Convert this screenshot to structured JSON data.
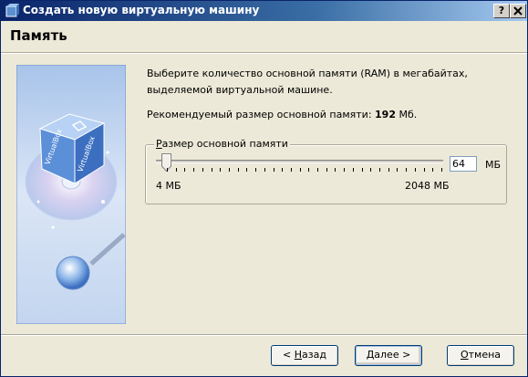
{
  "window": {
    "title": "Создать новую виртуальную машину",
    "help_button": "?",
    "close_button": "X"
  },
  "page": {
    "title": "Память"
  },
  "description": "Выберите количество основной памяти (RAM) в мегабайтах, выделяемой виртуальной машине.",
  "recommended": {
    "prefix": "Рекомендуемый размер основной памяти: ",
    "value": "192",
    "suffix": " Мб."
  },
  "memory_group": {
    "label_mnemonic": "Р",
    "label_rest": "азмер основной памяти",
    "min_label": "4 МБ",
    "max_label": "2048 МБ",
    "value": "64",
    "unit": "МБ",
    "slider_min": 4,
    "slider_max": 2048,
    "slider_value": 64
  },
  "buttons": {
    "back_prefix": "< ",
    "back_mnemonic": "Н",
    "back_rest": "азад",
    "next_mnemonic": "Д",
    "next_rest": "алее >",
    "cancel_prefix": "",
    "cancel_mnemonic": "О",
    "cancel_rest": "тмена"
  },
  "colors": {
    "titlebar": "#0a246a",
    "button_border": "#003c74",
    "face": "#ece9d8"
  }
}
